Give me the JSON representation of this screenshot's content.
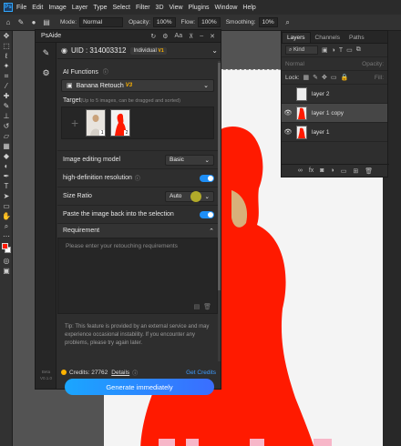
{
  "menu": [
    "File",
    "Edit",
    "Image",
    "Layer",
    "Type",
    "Select",
    "Filter",
    "3D",
    "View",
    "Plugins",
    "Window",
    "Help"
  ],
  "options": {
    "mode_label": "Mode:",
    "mode_value": "Normal",
    "opacity_label": "Opacity:",
    "opacity_value": "100%",
    "flow_label": "Flow:",
    "flow_value": "100%",
    "smoothing_label": "Smoothing:",
    "smoothing_value": "10%"
  },
  "psaide": {
    "title": "PsAide",
    "uid": "UID : 314003312",
    "plan": "Individual",
    "plan_tag": "V1",
    "version": "Beta V0.1.0",
    "ai_functions_label": "AI Functions",
    "function_value": "Banana Retouch",
    "function_version": "V3",
    "target_label": "Target",
    "target_hint": "(Up to 5 images, can be dragged and sorted)",
    "thumb_1_num": "1",
    "thumb_2_num": "2",
    "model_label": "Image editing model",
    "model_value": "Basic",
    "hd_label": "high-definition resolution",
    "ratio_label": "Size Ratio",
    "ratio_value": "Auto",
    "paste_label": "Paste the image back into the selection",
    "requirement_label": "Requirement",
    "requirement_placeholder": "Please enter your retouching requirements",
    "tip": "Tip: This feature is provided by an external service and may experience occasional instability. If you encounter any problems, please try again later.",
    "credits": "Credits: 27762",
    "details": "Details",
    "get_credits": "Get Credits",
    "generate": "Generate immediately",
    "hd_enabled": true,
    "paste_enabled": true
  },
  "layers_panel": {
    "tabs": [
      "Layers",
      "Channels",
      "Paths"
    ],
    "kind": "Kind",
    "blend": "Normal",
    "opacity": "Opacity:",
    "lock": "Lock:",
    "fill": "Fill:",
    "layers": [
      "layer 2",
      "layer 1 copy",
      "layer 1"
    ]
  },
  "colors": {
    "accent": "#1e8ef5",
    "foreground": "#ff1a00",
    "subject_red": "#ff1a00"
  }
}
